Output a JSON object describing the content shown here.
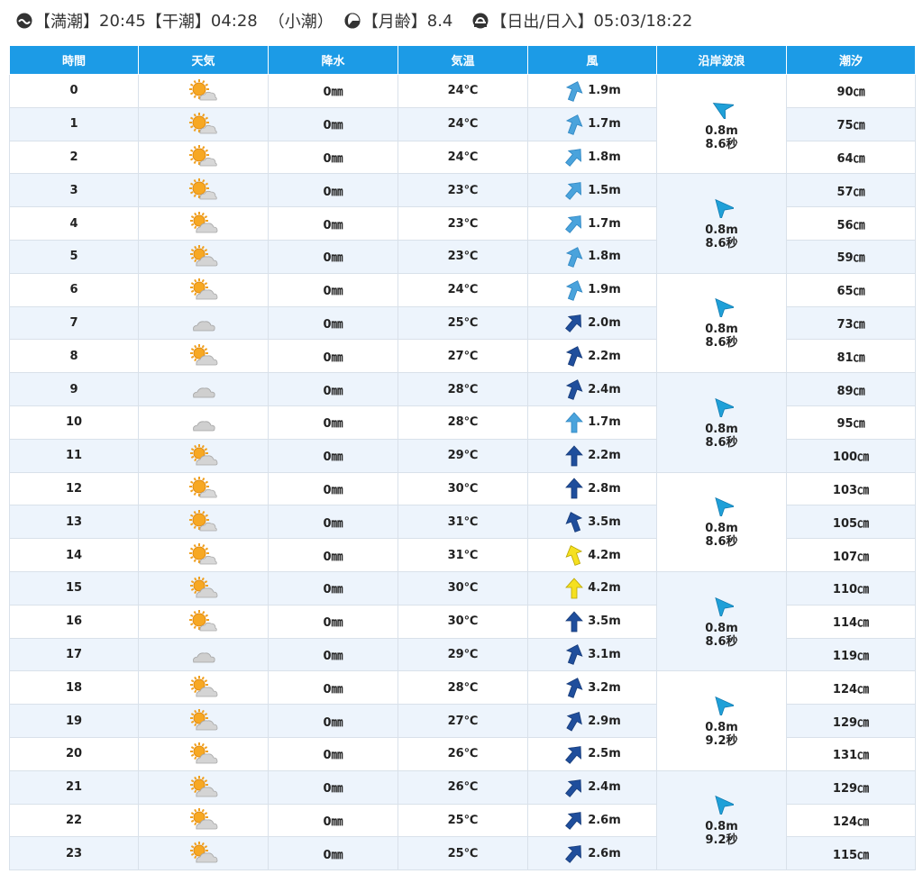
{
  "header": {
    "high_tide_label": "【満潮】",
    "high_tide_time": "20:45",
    "low_tide_label": "【干潮】",
    "low_tide_time": "04:28",
    "tide_type": "（小潮）",
    "moon_age_label": "【月齢】",
    "moon_age": "8.4",
    "sun_label": "【日出/日入】",
    "sun_times": "05:03/18:22"
  },
  "columns": [
    "時間",
    "天気",
    "降水",
    "気温",
    "風",
    "沿岸波浪",
    "潮汐"
  ],
  "colors": {
    "header_bg": "#1c9be6",
    "row_alt": "#edf4fc",
    "arrow_light": "#4aa3dc",
    "arrow_dark": "#1f4e9c",
    "arrow_yellow": "#f5e020",
    "wave_arrow": "#1fa0d8"
  },
  "rows": [
    {
      "hour": "0",
      "weather": "sunny-cloudy-icon",
      "precip": "0㎜",
      "temp": "24℃",
      "wind_dir": 20,
      "wind_color": "light",
      "wind_speed": "1.9m",
      "tide": "90㎝"
    },
    {
      "hour": "1",
      "weather": "sunny-cloudy-icon",
      "precip": "0㎜",
      "temp": "24℃",
      "wind_dir": 20,
      "wind_color": "light",
      "wind_speed": "1.7m",
      "tide": "75㎝"
    },
    {
      "hour": "2",
      "weather": "sunny-cloudy-icon",
      "precip": "0㎜",
      "temp": "24℃",
      "wind_dir": 40,
      "wind_color": "light",
      "wind_speed": "1.8m",
      "tide": "64㎝"
    },
    {
      "hour": "3",
      "weather": "sunny-cloudy-icon",
      "precip": "0㎜",
      "temp": "23℃",
      "wind_dir": 40,
      "wind_color": "light",
      "wind_speed": "1.5m",
      "tide": "57㎝"
    },
    {
      "hour": "4",
      "weather": "cloudy-sunny-icon",
      "precip": "0㎜",
      "temp": "23℃",
      "wind_dir": 40,
      "wind_color": "light",
      "wind_speed": "1.7m",
      "tide": "56㎝"
    },
    {
      "hour": "5",
      "weather": "cloudy-sunny-icon",
      "precip": "0㎜",
      "temp": "23℃",
      "wind_dir": 20,
      "wind_color": "light",
      "wind_speed": "1.8m",
      "tide": "59㎝"
    },
    {
      "hour": "6",
      "weather": "cloudy-sunny-icon",
      "precip": "0㎜",
      "temp": "24℃",
      "wind_dir": 20,
      "wind_color": "light",
      "wind_speed": "1.9m",
      "tide": "65㎝"
    },
    {
      "hour": "7",
      "weather": "cloudy-icon",
      "precip": "0㎜",
      "temp": "25℃",
      "wind_dir": 40,
      "wind_color": "dark",
      "wind_speed": "2.0m",
      "tide": "73㎝"
    },
    {
      "hour": "8",
      "weather": "cloudy-sunny-icon",
      "precip": "0㎜",
      "temp": "27℃",
      "wind_dir": 20,
      "wind_color": "dark",
      "wind_speed": "2.2m",
      "tide": "81㎝"
    },
    {
      "hour": "9",
      "weather": "cloudy-icon",
      "precip": "0㎜",
      "temp": "28℃",
      "wind_dir": 20,
      "wind_color": "dark",
      "wind_speed": "2.4m",
      "tide": "89㎝"
    },
    {
      "hour": "10",
      "weather": "cloudy-icon",
      "precip": "0㎜",
      "temp": "28℃",
      "wind_dir": 0,
      "wind_color": "light",
      "wind_speed": "1.7m",
      "tide": "95㎝"
    },
    {
      "hour": "11",
      "weather": "cloudy-sunny-icon",
      "precip": "0㎜",
      "temp": "29℃",
      "wind_dir": 0,
      "wind_color": "dark",
      "wind_speed": "2.2m",
      "tide": "100㎝"
    },
    {
      "hour": "12",
      "weather": "sunny-cloudy-icon",
      "precip": "0㎜",
      "temp": "30℃",
      "wind_dir": 0,
      "wind_color": "dark",
      "wind_speed": "2.8m",
      "tide": "103㎝"
    },
    {
      "hour": "13",
      "weather": "sunny-cloudy-icon",
      "precip": "0㎜",
      "temp": "31℃",
      "wind_dir": -20,
      "wind_color": "dark",
      "wind_speed": "3.5m",
      "tide": "105㎝"
    },
    {
      "hour": "14",
      "weather": "sunny-cloudy-icon",
      "precip": "0㎜",
      "temp": "31℃",
      "wind_dir": -20,
      "wind_color": "yellow",
      "wind_speed": "4.2m",
      "tide": "107㎝"
    },
    {
      "hour": "15",
      "weather": "cloudy-sunny-icon",
      "precip": "0㎜",
      "temp": "30℃",
      "wind_dir": 0,
      "wind_color": "yellow",
      "wind_speed": "4.2m",
      "tide": "110㎝"
    },
    {
      "hour": "16",
      "weather": "sunny-cloudy-icon",
      "precip": "0㎜",
      "temp": "30℃",
      "wind_dir": 0,
      "wind_color": "dark",
      "wind_speed": "3.5m",
      "tide": "114㎝"
    },
    {
      "hour": "17",
      "weather": "cloudy-icon",
      "precip": "0㎜",
      "temp": "29℃",
      "wind_dir": 20,
      "wind_color": "dark",
      "wind_speed": "3.1m",
      "tide": "119㎝"
    },
    {
      "hour": "18",
      "weather": "cloudy-sunny-icon",
      "precip": "0㎜",
      "temp": "28℃",
      "wind_dir": 20,
      "wind_color": "dark",
      "wind_speed": "3.2m",
      "tide": "124㎝"
    },
    {
      "hour": "19",
      "weather": "cloudy-sunny-icon",
      "precip": "0㎜",
      "temp": "27℃",
      "wind_dir": 30,
      "wind_color": "dark",
      "wind_speed": "2.9m",
      "tide": "129㎝"
    },
    {
      "hour": "20",
      "weather": "cloudy-sunny-icon",
      "precip": "0㎜",
      "temp": "26℃",
      "wind_dir": 40,
      "wind_color": "dark",
      "wind_speed": "2.5m",
      "tide": "131㎝"
    },
    {
      "hour": "21",
      "weather": "cloudy-sunny-icon",
      "precip": "0㎜",
      "temp": "26℃",
      "wind_dir": 40,
      "wind_color": "dark",
      "wind_speed": "2.4m",
      "tide": "129㎝"
    },
    {
      "hour": "22",
      "weather": "cloudy-sunny-icon",
      "precip": "0㎜",
      "temp": "25℃",
      "wind_dir": 40,
      "wind_color": "dark",
      "wind_speed": "2.6m",
      "tide": "124㎝"
    },
    {
      "hour": "23",
      "weather": "cloudy-sunny-icon",
      "precip": "0㎜",
      "temp": "25℃",
      "wind_dir": 40,
      "wind_color": "dark",
      "wind_speed": "2.6m",
      "tide": "115㎝"
    }
  ],
  "waves": [
    {
      "height": "0.8m",
      "period": "8.6秒",
      "dir": -60
    },
    {
      "height": "0.8m",
      "period": "8.6秒",
      "dir": -40
    },
    {
      "height": "0.8m",
      "period": "8.6秒",
      "dir": -40
    },
    {
      "height": "0.8m",
      "period": "8.6秒",
      "dir": -40
    },
    {
      "height": "0.8m",
      "period": "8.6秒",
      "dir": -40
    },
    {
      "height": "0.8m",
      "period": "8.6秒",
      "dir": -40
    },
    {
      "height": "0.8m",
      "period": "9.2秒",
      "dir": -40
    },
    {
      "height": "0.8m",
      "period": "9.2秒",
      "dir": -40
    }
  ]
}
